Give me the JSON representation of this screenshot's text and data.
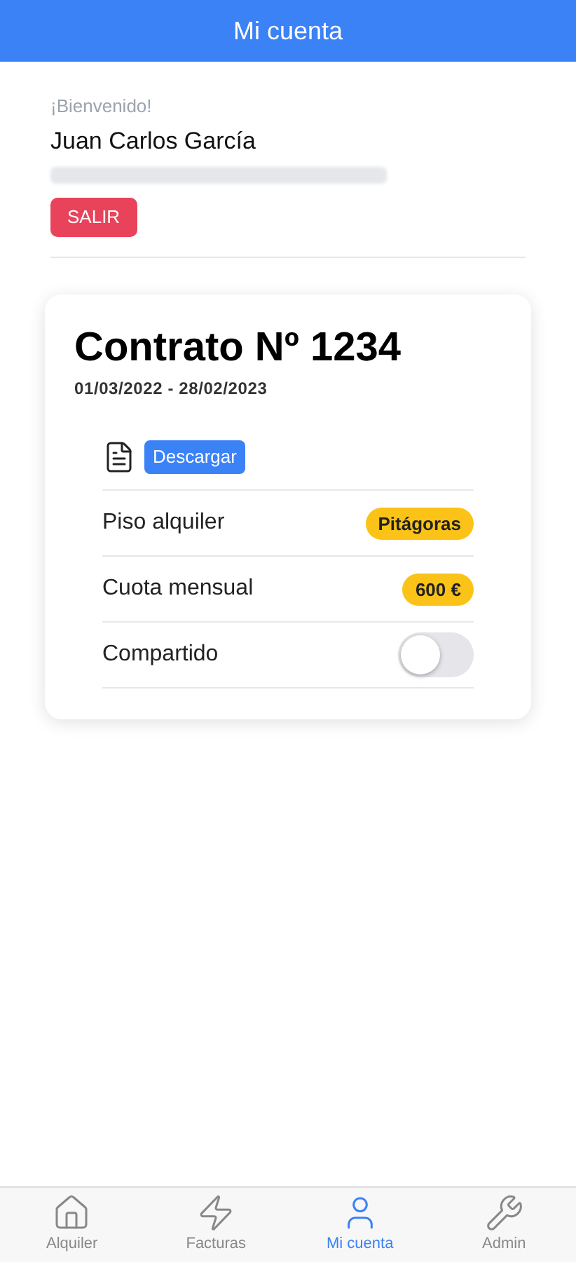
{
  "header": {
    "title": "Mi cuenta"
  },
  "account": {
    "greeting": "¡Bienvenido!",
    "name": "Juan Carlos García",
    "logout": "SALIR"
  },
  "contract": {
    "title": "Contrato Nº 1234",
    "period": "01/03/2022 - 28/02/2023",
    "download": "Descargar",
    "rows": [
      {
        "kind": "badge",
        "label": "Piso alquiler",
        "value": "Pitágoras"
      },
      {
        "kind": "badge",
        "label": "Cuota mensual",
        "value": "600 €"
      },
      {
        "kind": "toggle",
        "label": "Compartido",
        "on": false
      }
    ]
  },
  "tabs": [
    {
      "label": "Alquiler",
      "selected": false
    },
    {
      "label": "Facturas",
      "selected": false
    },
    {
      "label": "Mi cuenta",
      "selected": true
    },
    {
      "label": "Admin",
      "selected": false
    }
  ]
}
